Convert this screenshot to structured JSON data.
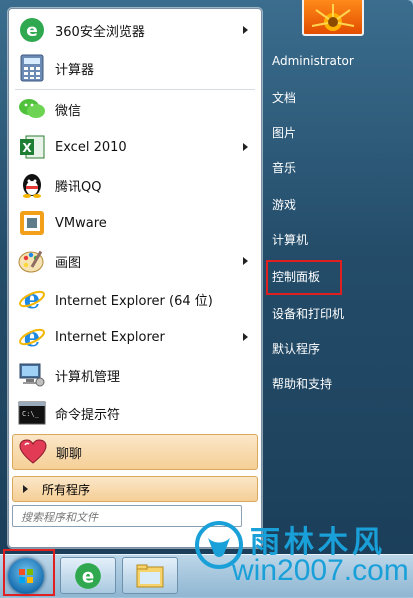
{
  "programs": [
    {
      "label": "360安全浏览器",
      "icon": "360-browser-icon",
      "arrow": true
    },
    {
      "label": "计算器",
      "icon": "calculator-icon",
      "arrow": false
    },
    {
      "label": "微信",
      "icon": "wechat-icon",
      "arrow": false
    },
    {
      "label": "Excel 2010",
      "icon": "excel-icon",
      "arrow": true
    },
    {
      "label": "腾讯QQ",
      "icon": "qq-icon",
      "arrow": false
    },
    {
      "label": "VMware",
      "icon": "vmware-icon",
      "arrow": false
    },
    {
      "label": "画图",
      "icon": "paint-icon",
      "arrow": true
    },
    {
      "label": "Internet Explorer (64 位)",
      "icon": "ie-icon",
      "arrow": false
    },
    {
      "label": "Internet Explorer",
      "icon": "ie-icon",
      "arrow": true
    },
    {
      "label": "计算机管理",
      "icon": "computer-management-icon",
      "arrow": false
    },
    {
      "label": "命令提示符",
      "icon": "cmd-icon",
      "arrow": false
    },
    {
      "label": "聊聊",
      "icon": "chat-heart-icon",
      "arrow": false
    }
  ],
  "all_programs": "所有程序",
  "search_placeholder": "搜索程序和文件",
  "right_items": [
    "Administrator",
    "文档",
    "图片",
    "音乐",
    "游戏",
    "计算机",
    "控制面板",
    "设备和打印机",
    "默认程序",
    "帮助和支持"
  ],
  "watermark": {
    "brand": "雨林木风",
    "url": "win2007.com"
  },
  "colors": {
    "highlight_box": "#e02020",
    "watermark": "#1aa0d8"
  }
}
